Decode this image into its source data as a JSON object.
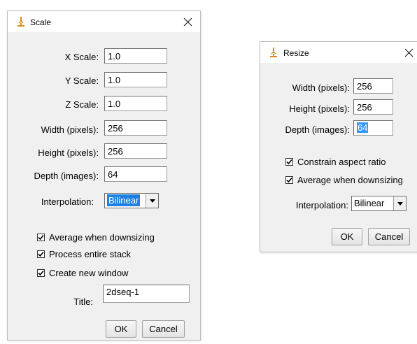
{
  "scale_dialog": {
    "title": "Scale",
    "fields": [
      {
        "label": "X Scale:",
        "value": "1.0"
      },
      {
        "label": "Y Scale:",
        "value": "1.0"
      },
      {
        "label": "Z Scale:",
        "value": "1.0"
      },
      {
        "label": "Width (pixels):",
        "value": "256"
      },
      {
        "label": "Height (pixels):",
        "value": "256"
      },
      {
        "label": "Depth (images):",
        "value": "64"
      }
    ],
    "interpolation_label": "Interpolation:",
    "interpolation_value": "Bilinear",
    "checkboxes": [
      {
        "label": "Average when downsizing",
        "checked": true
      },
      {
        "label": "Process entire stack",
        "checked": true
      },
      {
        "label": "Create new window",
        "checked": true
      }
    ],
    "title_field_label": "Title:",
    "title_field_value": "2dseq-1",
    "ok_label": "OK",
    "cancel_label": "Cancel"
  },
  "resize_dialog": {
    "title": "Resize",
    "fields": [
      {
        "label": "Width (pixels):",
        "value": "256"
      },
      {
        "label": "Height (pixels):",
        "value": "256"
      },
      {
        "label": "Depth (images):",
        "value": "64"
      }
    ],
    "checkboxes": [
      {
        "label": "Constrain aspect ratio",
        "checked": true
      },
      {
        "label": "Average when downsizing",
        "checked": true
      }
    ],
    "interpolation_label": "Interpolation:",
    "interpolation_value": "Bilinear",
    "ok_label": "OK",
    "cancel_label": "Cancel"
  },
  "icons": {
    "app_icon": "microscope-icon",
    "close_icon": "close-icon",
    "dropdown_icon": "chevron-down-icon",
    "check_icon": "checkmark-icon"
  },
  "colors": {
    "dialog_bg": "#f0f0f0",
    "titlebar_bg": "#ffffff",
    "selection": "#3399ff",
    "app_icon": "#d98a1a"
  }
}
